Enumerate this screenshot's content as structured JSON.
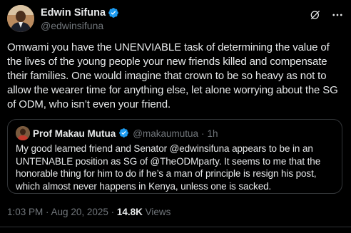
{
  "author": {
    "display_name": "Edwin Sifuna",
    "handle": "@edwinsifuna",
    "verified": true
  },
  "tweet": {
    "text": "Omwami you have the UNENVIABLE task of determining the value of the lives of the young people your new friends killed and compensate their families. One would imagine that crown to be so heavy as not to allow the wearer time for anything else, let alone worrying about the SG of ODM, who isn’t even your friend."
  },
  "quote": {
    "display_name": "Prof Makau Mutua",
    "handle": "@makaumutua",
    "separator": "·",
    "time": "1h",
    "verified": true,
    "text": "My good learned friend and Senator @edwinsifuna appears to be in an UNTENABLE position as SG of @TheODMparty.  It seems to me that the honorable thing for him to do if he’s a man of principle is resign his post, which almost never happens in Kenya, unless one is sacked."
  },
  "meta": {
    "time": "1:03 PM",
    "separator1": " · ",
    "date": "Aug 20, 2025",
    "separator2": " · ",
    "views_count": "14.8K",
    "views_label": " Views"
  },
  "icons": {
    "verified": "verified-badge-icon",
    "grok": "grok-icon",
    "more": "more-icon"
  },
  "colors": {
    "background": "#000000",
    "text": "#e7e9ea",
    "secondary": "#71767b",
    "verified": "#1d9bf0",
    "border": "#333639"
  }
}
